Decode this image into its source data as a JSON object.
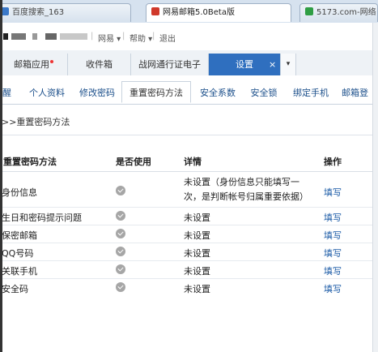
{
  "browser_tabs": [
    {
      "label": "百度搜索_163",
      "color": "#3a78c8"
    },
    {
      "label": "网易邮箱5.0Beta版",
      "color": "#d0392b"
    },
    {
      "label": "5173.com-网络",
      "color": "#2f9e44"
    }
  ],
  "user_bar": {
    "links": [
      "网易 ▾",
      "帮助 ▾",
      "退出"
    ],
    "separators": [
      "|",
      "|",
      "|"
    ]
  },
  "mail_tabs": [
    "邮箱应用",
    "收件箱",
    "战网通行证电子",
    "设置"
  ],
  "mail_tab_close": "×",
  "mail_tab_more": "▾",
  "sub_nav": [
    "提醒",
    "个人资料",
    "修改密码",
    "重置密码方法",
    "安全系数",
    "安全锁",
    "绑定手机",
    "邮箱登"
  ],
  "breadcrumb": ">>重置密码方法",
  "table": {
    "headers": [
      "重置密码方法",
      "是否使用",
      "详情",
      "操作"
    ],
    "rows": [
      {
        "method": "身份信息",
        "detail_lines": [
          "未设置（身份信息只能填写一",
          "次，是判断帐号归属重要依据）"
        ],
        "action": "填写"
      },
      {
        "method": "生日和密码提示问题",
        "detail_lines": [
          "未设置"
        ],
        "action": "填写"
      },
      {
        "method": "保密邮箱",
        "detail_lines": [
          "未设置"
        ],
        "action": "填写"
      },
      {
        "method": "QQ号码",
        "detail_lines": [
          "未设置"
        ],
        "action": "填写"
      },
      {
        "method": "关联手机",
        "detail_lines": [
          "未设置"
        ],
        "action": "填写"
      },
      {
        "method": "安全码",
        "detail_lines": [
          "未设置"
        ],
        "action": "填写"
      }
    ]
  }
}
